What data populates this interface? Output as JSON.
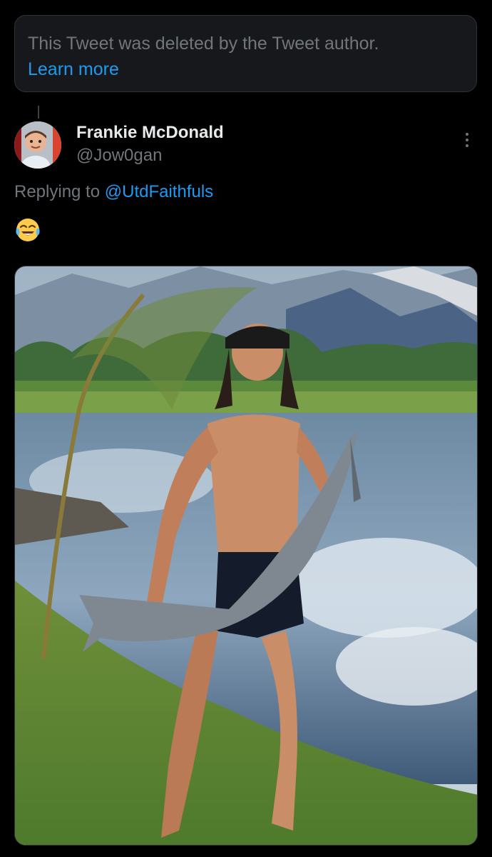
{
  "deleted_notice": {
    "text": "This Tweet was deleted by the Tweet author.",
    "link": "Learn more"
  },
  "tweet": {
    "author_name": "Frankie McDonald",
    "author_handle": "@Jow0gan",
    "replying_prefix": "Replying to ",
    "replying_handle": "@UtdFaithfuls",
    "emoji_icon": "face-with-tears-of-joy-icon",
    "more_icon": "more-options-icon"
  },
  "colors": {
    "background": "#000000",
    "card": "#16181c",
    "accent": "#1d9bf0",
    "muted": "#71767b",
    "text": "#e7e9ea"
  }
}
